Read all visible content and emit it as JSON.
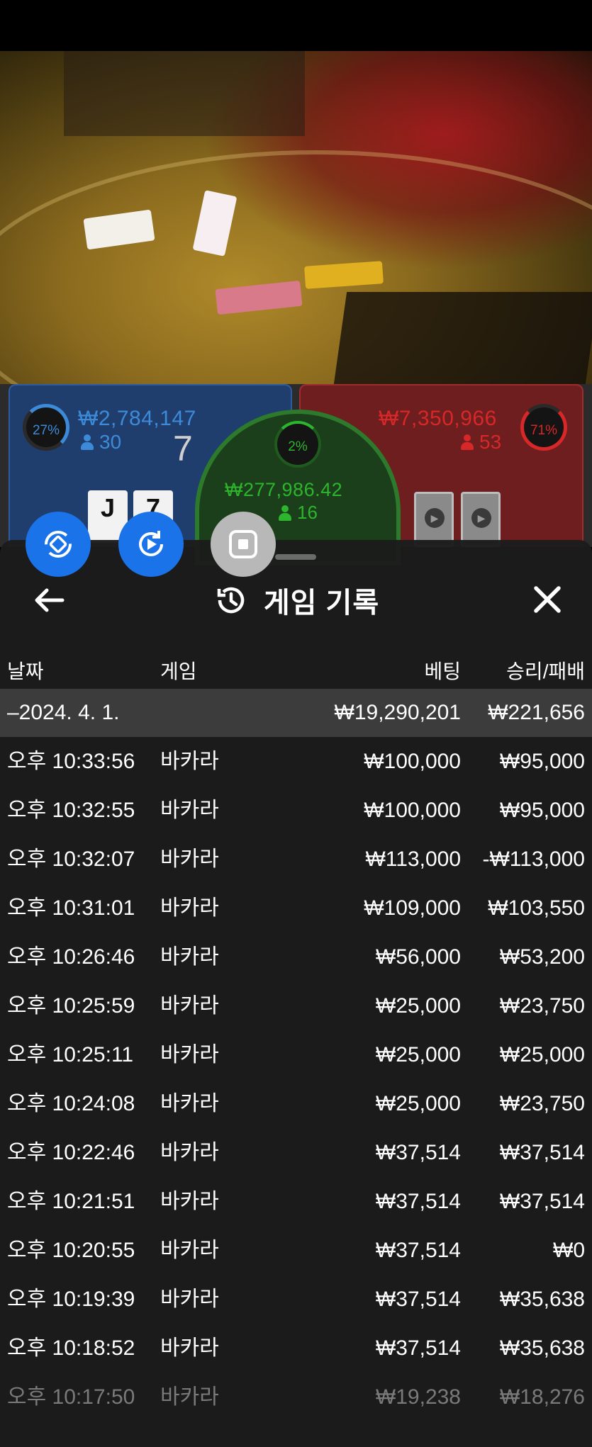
{
  "board": {
    "player": {
      "percent": "27%",
      "amount": "₩2,784,147",
      "count": "30",
      "score": "7",
      "cards": [
        "J",
        "7"
      ]
    },
    "tie": {
      "percent": "2%",
      "amount": "₩277,986.42",
      "count": "16"
    },
    "banker": {
      "percent": "71%",
      "amount": "₩7,350,966",
      "count": "53"
    },
    "colors": {
      "player": "#3d8bd8",
      "banker": "#d62828",
      "tie": "#2db52d"
    }
  },
  "panel": {
    "title": "게임 기록",
    "columns": {
      "date": "날짜",
      "game": "게임",
      "bet": "베팅",
      "winloss": "승리/패배"
    },
    "summary": {
      "date": "–2024. 4. 1.",
      "bet": "₩19,290,201",
      "winloss": "₩221,656"
    },
    "rows": [
      {
        "time": "오후 10:33:56",
        "game": "바카라",
        "bet": "₩100,000",
        "winloss": "₩95,000"
      },
      {
        "time": "오후 10:32:55",
        "game": "바카라",
        "bet": "₩100,000",
        "winloss": "₩95,000"
      },
      {
        "time": "오후 10:32:07",
        "game": "바카라",
        "bet": "₩113,000",
        "winloss": "-₩113,000"
      },
      {
        "time": "오후 10:31:01",
        "game": "바카라",
        "bet": "₩109,000",
        "winloss": "₩103,550"
      },
      {
        "time": "오후 10:26:46",
        "game": "바카라",
        "bet": "₩56,000",
        "winloss": "₩53,200"
      },
      {
        "time": "오후 10:25:59",
        "game": "바카라",
        "bet": "₩25,000",
        "winloss": "₩23,750"
      },
      {
        "time": "오후 10:25:11",
        "game": "바카라",
        "bet": "₩25,000",
        "winloss": "₩25,000"
      },
      {
        "time": "오후 10:24:08",
        "game": "바카라",
        "bet": "₩25,000",
        "winloss": "₩23,750"
      },
      {
        "time": "오후 10:22:46",
        "game": "바카라",
        "bet": "₩37,514",
        "winloss": "₩37,514"
      },
      {
        "time": "오후 10:21:51",
        "game": "바카라",
        "bet": "₩37,514",
        "winloss": "₩37,514"
      },
      {
        "time": "오후 10:20:55",
        "game": "바카라",
        "bet": "₩37,514",
        "winloss": "₩0"
      },
      {
        "time": "오후 10:19:39",
        "game": "바카라",
        "bet": "₩37,514",
        "winloss": "₩35,638"
      },
      {
        "time": "오후 10:18:52",
        "game": "바카라",
        "bet": "₩37,514",
        "winloss": "₩35,638"
      },
      {
        "time": "오후 10:17:50",
        "game": "바카라",
        "bet": "₩19,238",
        "winloss": "₩18,276"
      }
    ]
  },
  "buttons": {
    "rotate": "rotate-icon",
    "replay": "replay-icon",
    "stop": "stop-icon",
    "back": "arrow-left-icon",
    "close": "close-icon",
    "history": "history-icon"
  }
}
